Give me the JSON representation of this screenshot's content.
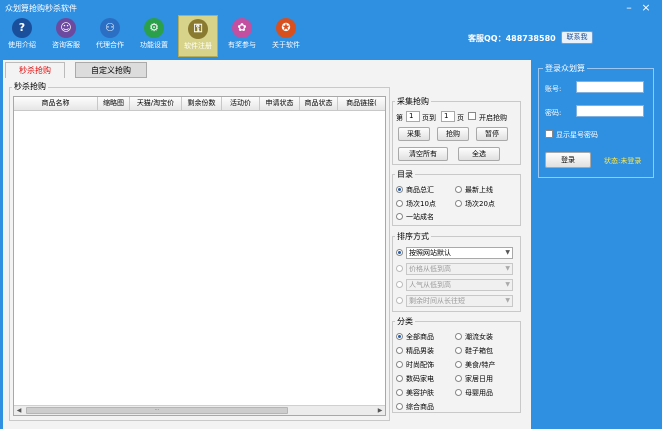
{
  "window": {
    "title": "众划算抢购秒杀软件",
    "minimize_icon": "minimize-icon",
    "close_icon": "close-icon"
  },
  "toolbar": {
    "items": [
      {
        "label": "使用介绍",
        "icon": "help-icon",
        "glyph": "?",
        "color": "#1a4f9c"
      },
      {
        "label": "咨询客服",
        "icon": "support-icon",
        "glyph": "☺",
        "color": "#6c4aa0"
      },
      {
        "label": "代理合作",
        "icon": "partner-icon",
        "glyph": "⚇",
        "color": "#2b6fc4"
      },
      {
        "label": "功能设置",
        "icon": "settings-icon",
        "glyph": "⚙",
        "color": "#2aa04a"
      },
      {
        "label": "软件注册",
        "icon": "key-icon",
        "glyph": "⚿",
        "color": "#8a7a30"
      },
      {
        "label": "有奖参与",
        "icon": "gift-icon",
        "glyph": "✿",
        "color": "#c24fa0"
      },
      {
        "label": "关于软件",
        "icon": "about-icon",
        "glyph": "✪",
        "color": "#d8501e"
      }
    ],
    "active_index": 4
  },
  "service": {
    "text": "客服QQ：488738580",
    "qq_button": "联系我"
  },
  "tabs": [
    "秒杀抢购",
    "自定义抢购"
  ],
  "left_group": {
    "title": "秒杀抢购",
    "columns": [
      "商品名称",
      "缩略图",
      "天猫/淘宝价",
      "剩余份数",
      "活动价",
      "申请状态",
      "商品状态",
      "商品链接("
    ],
    "scroll_thumb": "⋯"
  },
  "collect": {
    "title": "采集抢购",
    "page_prefix": "第",
    "page_from": "1",
    "page_to_label": "页到",
    "page_to": "1",
    "page_suffix": "页",
    "auto_grab": "开启抢购",
    "buttons": [
      "采集",
      "抢购",
      "暂停",
      "清空所有",
      "全选"
    ]
  },
  "catalog": {
    "title": "目录",
    "options": [
      "商品总汇",
      "最新上线",
      "场次10点",
      "场次20点",
      "一站成名"
    ],
    "selected": 0
  },
  "sort": {
    "title": "排序方式",
    "options": [
      "按照网站默认",
      "价格从低到高",
      "人气从低到高",
      "剩余时间从长往短"
    ],
    "selected": 0
  },
  "category": {
    "title": "分类",
    "options": [
      "全部商品",
      "潮流女装",
      "精品男装",
      "鞋子箱包",
      "时尚配饰",
      "美食/特产",
      "数码家电",
      "家居日用",
      "美容护肤",
      "母婴用品",
      "综合商品"
    ],
    "selected": 0
  },
  "login": {
    "title": "登录众划算",
    "account_label": "账号:",
    "account_value": "",
    "password_label": "密码:",
    "password_value": "",
    "show_password": "显示星号密码",
    "login_button": "登录",
    "status": "状态:未登录"
  }
}
